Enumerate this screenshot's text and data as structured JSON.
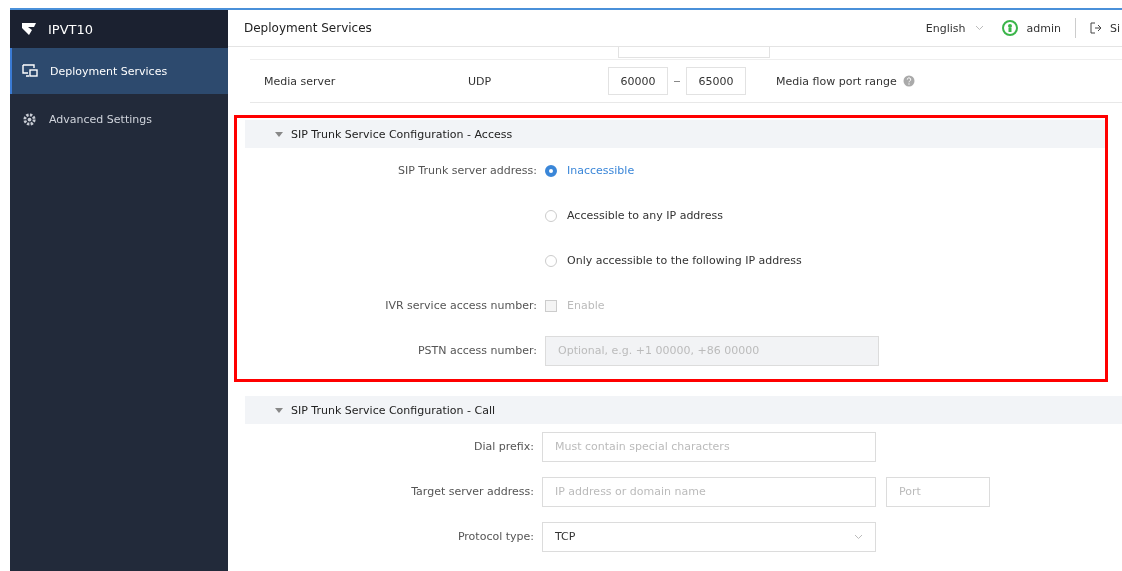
{
  "app": {
    "name": "IPVT10"
  },
  "sidebar": {
    "items": [
      {
        "label": "Deployment Services",
        "selected": true
      },
      {
        "label": "Advanced Settings",
        "selected": false
      }
    ]
  },
  "header": {
    "title": "Deployment Services",
    "language": "English",
    "user": "admin",
    "sign_out": "Si"
  },
  "media_row": {
    "label": "Media server",
    "protocol": "UDP",
    "port_from": "60000",
    "port_to": "65000",
    "description": "Media flow port range"
  },
  "sections": [
    {
      "title": "SIP Trunk Service Configuration - Access",
      "highlighted": true,
      "fields": [
        {
          "kind": "radio",
          "label": "SIP Trunk server address:",
          "options": [
            {
              "label": "Inaccessible",
              "selected": true
            },
            {
              "label": "Accessible to any IP address",
              "selected": false
            },
            {
              "label": "Only accessible to the following IP address",
              "selected": false
            }
          ]
        },
        {
          "kind": "checkbox",
          "label": "IVR service access number:",
          "option": "Enable",
          "checked": false,
          "disabled": true
        },
        {
          "kind": "input",
          "label": "PSTN access number:",
          "placeholder": "Optional, e.g. +1 00000, +86 00000",
          "disabled": true
        }
      ]
    },
    {
      "title": "SIP Trunk Service Configuration - Call",
      "highlighted": false,
      "fields": [
        {
          "kind": "input",
          "label": "Dial prefix:",
          "placeholder": "Must contain special characters",
          "disabled": false
        },
        {
          "kind": "address",
          "label": "Target server address:",
          "placeholder": "IP address or domain name",
          "port_placeholder": "Port"
        },
        {
          "kind": "select",
          "label": "Protocol type:",
          "value": "TCP"
        }
      ]
    }
  ]
}
